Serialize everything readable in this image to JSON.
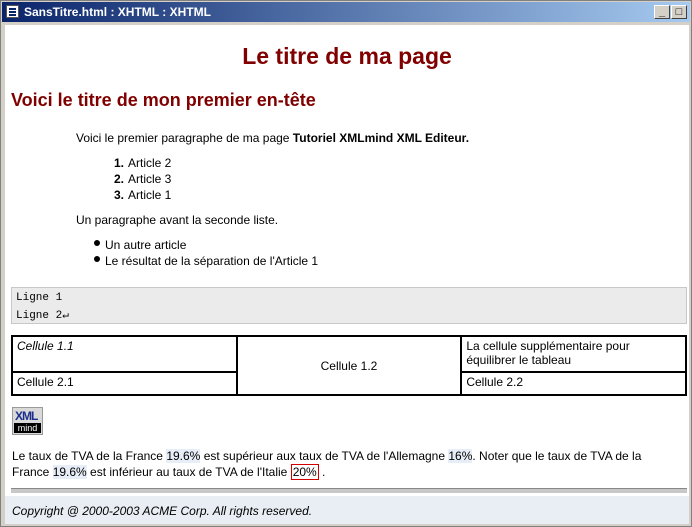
{
  "window": {
    "title": "SansTitre.html : XHTML : XHTML",
    "minimize_glyph": "_",
    "maximize_glyph": "□"
  },
  "page": {
    "title": "Le titre de ma page",
    "heading": "Voici le titre de mon premier en-tête",
    "intro_text": "Voici le premier paragraphe de ma page ",
    "intro_bold": "Tutoriel XMLmind XML Editeur.",
    "ordered_list": [
      {
        "num": "1.",
        "text": "Article 2"
      },
      {
        "num": "2.",
        "text": "Article 3"
      },
      {
        "num": "3.",
        "text": "Article 1"
      }
    ],
    "second_paragraph": "Un paragraphe avant la seconde liste.",
    "bullet_list": [
      "Un autre article",
      "Le résultat de la séparation de l'Article 1"
    ],
    "pre_lines": [
      "Ligne 1",
      "Ligne 2↵"
    ],
    "table": {
      "r1c1": "Cellule 1.1",
      "r1c2": "Cellule 1.2",
      "r1c3": "La cellule supplémentaire pour équilibrer le tableau",
      "r2c1": "Cellule 2.1",
      "r2c3": "Cellule 2.2"
    },
    "logo": {
      "line1": "XML",
      "line2": "mind"
    },
    "vat": {
      "t1": "Le taux de TVA de la France ",
      "v1": "19.6%",
      "t2": " est supérieur aux taux de TVA de l'Allemagne ",
      "v2": "16%",
      "t3": ". Noter que le taux de TVA de la",
      "t4": "France ",
      "v3": "19.6%",
      "t5": " est inférieur au taux de TVA de l'Italie ",
      "v4": "20%",
      "t6": " ."
    },
    "footer": "Copyright @ 2000-2003 ACME Corp. All rights reserved."
  },
  "colors": {
    "heading": "#800000",
    "titlebar_start": "#0a246a",
    "titlebar_end": "#a6caf0",
    "highlight_box": "#d00000"
  }
}
